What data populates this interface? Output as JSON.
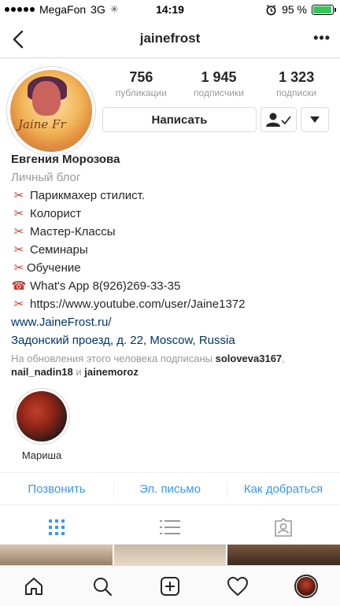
{
  "status_bar": {
    "carrier": "MegaFon",
    "network": "3G",
    "time": "14:19",
    "battery": "95 %",
    "battery_level": 0.95
  },
  "header": {
    "username": "jainefrost",
    "back_icon": "chevron-left-icon",
    "more_icon": "more-horizontal-icon"
  },
  "profile": {
    "avatar_text": "Jaine Fr",
    "stats": [
      {
        "value": "756",
        "label": "публикации"
      },
      {
        "value": "1 945",
        "label": "подписчики"
      },
      {
        "value": "1 323",
        "label": "подписки"
      }
    ],
    "message_button": "Написать"
  },
  "bio": {
    "name": "Евгения Морозова",
    "category": "Личный блог",
    "lines": [
      "Парикмахер стилист.",
      "Колорист",
      "Мастер-Классы",
      "Семинары",
      "Обучение"
    ],
    "whatsapp": "What's App 8(926)269-33-35",
    "youtube": "https://www.youtube.com/user/Jaine1372",
    "website": "www.JaineFrost.ru/",
    "address": "Задонский проезд, д. 22, Moscow, Russia",
    "followed_by_prefix": "На обновления этого человека подписаны ",
    "followed_by_user1": "soloveva3167",
    "followed_by_sep": ",",
    "followed_by_user2": "nail_nadin18",
    "followed_by_and": " и ",
    "followed_by_user3": "jainemoroz"
  },
  "highlights": [
    {
      "label": "Мариша"
    }
  ],
  "contacts": {
    "call": "Позвонить",
    "email": "Эл. письмо",
    "directions": "Как добраться"
  },
  "colors": {
    "link_blue": "#3897f0",
    "dark_link": "#003569",
    "tab_active": "#3897f0",
    "text": "#262626",
    "muted": "#999999"
  }
}
